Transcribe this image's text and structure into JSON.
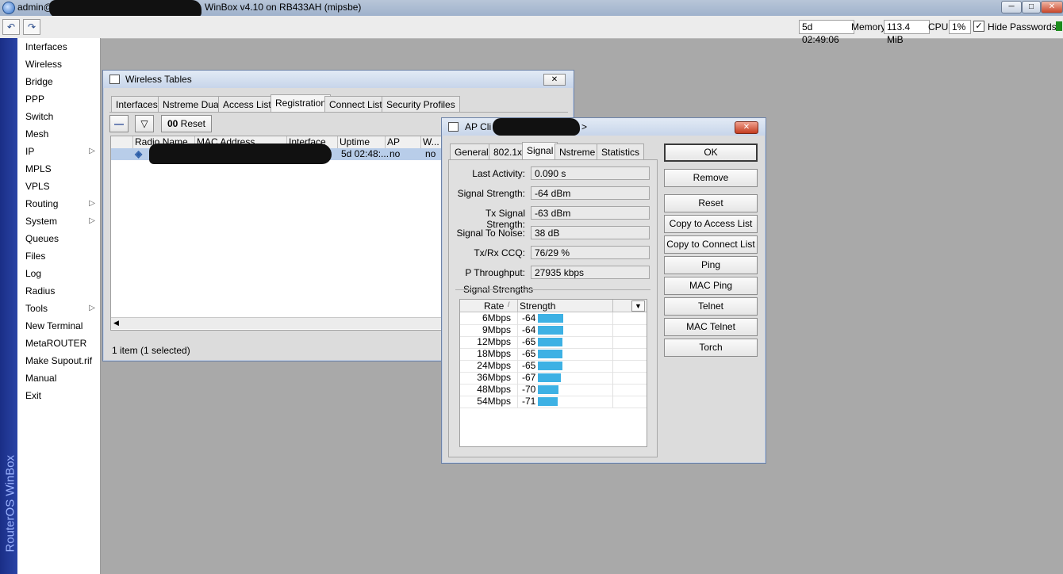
{
  "window": {
    "user": "admin@",
    "title": "WinBox v4.10 on RB433AH (mipsbe)",
    "min_glyph": "─",
    "max_glyph": "□",
    "close_glyph": "✕"
  },
  "toolbar": {
    "undo_glyph": "↶",
    "redo_glyph": "↷",
    "uptime": "5d 02:49:06",
    "memory_label": "Memory:",
    "memory_value": "113.4 MiB",
    "cpu_label": "CPU:",
    "cpu_value": "1%",
    "hide_passwords_label": "Hide Passwords",
    "hide_passwords_checked": true
  },
  "brand_strip": "RouterOS WinBox",
  "sidebar": {
    "items": [
      {
        "label": "Interfaces"
      },
      {
        "label": "Wireless"
      },
      {
        "label": "Bridge"
      },
      {
        "label": "PPP"
      },
      {
        "label": "Switch"
      },
      {
        "label": "Mesh"
      },
      {
        "label": "IP",
        "submenu": true
      },
      {
        "label": "MPLS"
      },
      {
        "label": "VPLS"
      },
      {
        "label": "Routing",
        "submenu": true
      },
      {
        "label": "System",
        "submenu": true
      },
      {
        "label": "Queues"
      },
      {
        "label": "Files"
      },
      {
        "label": "Log"
      },
      {
        "label": "Radius"
      },
      {
        "label": "Tools",
        "submenu": true
      },
      {
        "label": "New Terminal"
      },
      {
        "label": "MetaROUTER"
      },
      {
        "label": "Make Supout.rif"
      },
      {
        "label": "Manual"
      },
      {
        "label": "Exit"
      }
    ],
    "arrow_glyph": "▷"
  },
  "wireless_tables": {
    "title": "Wireless Tables",
    "tabs": [
      "Interfaces",
      "Nstreme Dual",
      "Access List",
      "Registration",
      "Connect List",
      "Security Profiles"
    ],
    "active_tab": "Registration",
    "buttons": {
      "remove_glyph": "—",
      "filter_glyph": "▽",
      "reset_prefix": "00",
      "reset_label": "Reset"
    },
    "columns": [
      "Radio Name",
      "MAC Address",
      "Interface",
      "Uptime",
      "AP",
      "W..."
    ],
    "rows": [
      {
        "icon": "◈",
        "uptime": "5d 02:48:...",
        "ap": "no",
        "w": "no"
      }
    ],
    "status": "1 item (1 selected)",
    "scroll_left_glyph": "◀"
  },
  "ap_client": {
    "title": "AP Cli",
    "title_suffix": ">",
    "tabs": [
      "General",
      "802.1x",
      "Signal",
      "Nstreme",
      "Statistics"
    ],
    "active_tab": "Signal",
    "fields": [
      {
        "label": "Last Activity:",
        "value": "0.090 s"
      },
      {
        "label": "Signal Strength:",
        "value": "-64 dBm"
      },
      {
        "label": "Tx Signal Strength:",
        "value": "-63 dBm"
      },
      {
        "label": "Signal To Noise:",
        "value": "38 dB"
      },
      {
        "label": "Tx/Rx CCQ:",
        "value": "76/29 %"
      },
      {
        "label": "P Throughput:",
        "value": "27935 kbps"
      }
    ],
    "signal_strengths_label": "Signal Strengths",
    "grid_columns": {
      "rate": "Rate",
      "sort_glyph": "/",
      "strength": "Strength",
      "dropdown_glyph": "▼"
    },
    "signal_rows": [
      {
        "rate": "6Mbps",
        "strength": -64
      },
      {
        "rate": "9Mbps",
        "strength": -64
      },
      {
        "rate": "12Mbps",
        "strength": -65
      },
      {
        "rate": "18Mbps",
        "strength": -65
      },
      {
        "rate": "24Mbps",
        "strength": -65
      },
      {
        "rate": "36Mbps",
        "strength": -67
      },
      {
        "rate": "48Mbps",
        "strength": -70
      },
      {
        "rate": "54Mbps",
        "strength": -71
      }
    ],
    "bar_color": "#3db1e4",
    "buttons": [
      "OK",
      "Remove",
      "Reset",
      "Copy to Access List",
      "Copy to Connect List",
      "Ping",
      "MAC Ping",
      "Telnet",
      "MAC Telnet",
      "Torch"
    ],
    "close_glyph": "✕"
  }
}
